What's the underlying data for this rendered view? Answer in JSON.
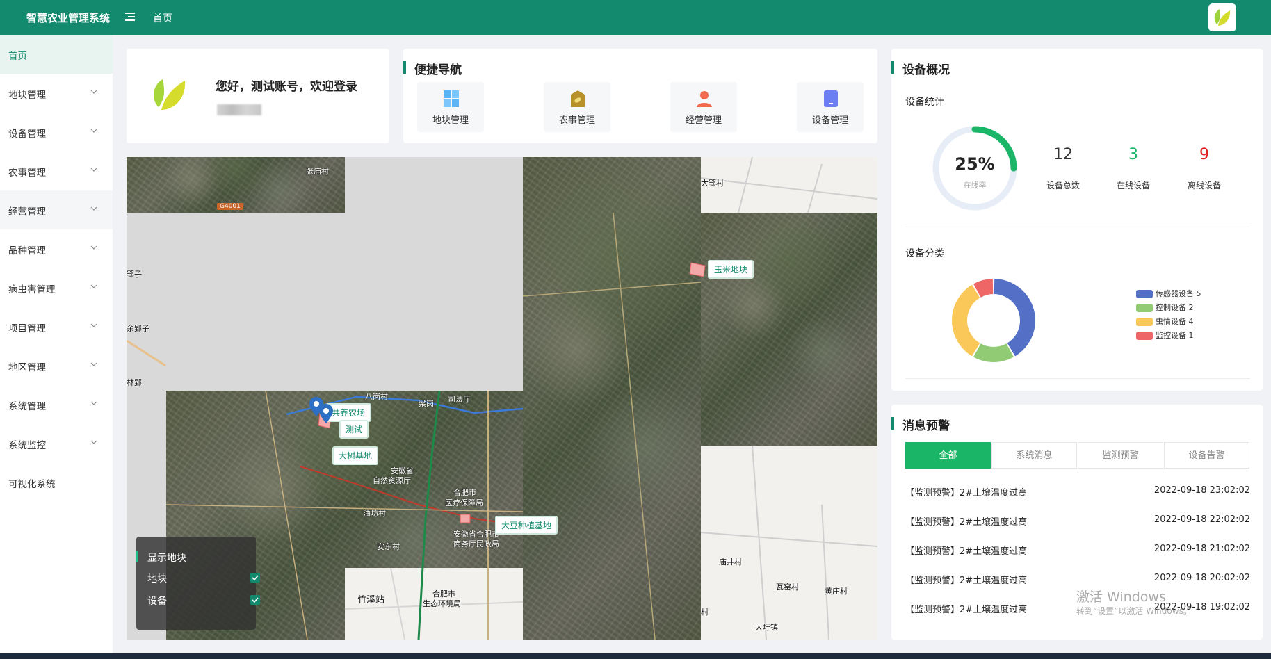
{
  "header": {
    "title": "智慧农业管理系统",
    "breadcrumb": "首页"
  },
  "sidebar": {
    "items": [
      {
        "label": "首页"
      },
      {
        "label": "地块管理"
      },
      {
        "label": "设备管理"
      },
      {
        "label": "农事管理"
      },
      {
        "label": "经营管理"
      },
      {
        "label": "品种管理"
      },
      {
        "label": "病虫害管理"
      },
      {
        "label": "项目管理"
      },
      {
        "label": "地区管理"
      },
      {
        "label": "系统管理"
      },
      {
        "label": "系统监控"
      },
      {
        "label": "可视化系统"
      }
    ]
  },
  "welcome": {
    "greeting": "您好，测试账号，欢迎登录"
  },
  "quick_nav": {
    "title": "便捷导航",
    "items": [
      {
        "label": "地块管理",
        "icon": "plot-icon"
      },
      {
        "label": "农事管理",
        "icon": "farming-icon"
      },
      {
        "label": "经营管理",
        "icon": "user-icon"
      },
      {
        "label": "设备管理",
        "icon": "device-icon"
      }
    ]
  },
  "map": {
    "place_labels": [
      "张庙村",
      "大郢村",
      "郢子",
      "余郢子",
      "林郢",
      "八岗村",
      "梁岗",
      "司法厅",
      "安徽省",
      "自然资源厅",
      "合肥市",
      "医疗保障局",
      "油坊村",
      "安东村",
      "安徽省合肥市",
      "商务厅民政局",
      "竹溪站",
      "合肥市",
      "生态环境局",
      "庙井村",
      "瓦窑村",
      "黄庄村",
      "大圩镇",
      "村"
    ],
    "road_badge": "G4001",
    "plot_tags": [
      "玉米地块",
      "共养农场",
      "测试",
      "大树基地",
      "大豆种植基地"
    ],
    "layers": {
      "title": "显示地块",
      "items": [
        {
          "label": "地块",
          "checked": true
        },
        {
          "label": "设备",
          "checked": true
        }
      ]
    }
  },
  "overview": {
    "title": "设备概况",
    "stats_title": "设备统计",
    "online_rate": "25%",
    "online_rate_value": 25,
    "online_rate_label": "在线率",
    "total": {
      "value": "12",
      "label": "设备总数",
      "color": "#333333"
    },
    "online": {
      "value": "3",
      "label": "在线设备",
      "color": "#1ab566"
    },
    "offline": {
      "value": "9",
      "label": "离线设备",
      "color": "#e02020"
    },
    "category_title": "设备分类",
    "categories": [
      {
        "label": "传感器设备 5",
        "value": 5,
        "color": "#5470c6"
      },
      {
        "label": "控制设备 2",
        "value": 2,
        "color": "#91cc75"
      },
      {
        "label": "虫情设备 4",
        "value": 4,
        "color": "#fac858"
      },
      {
        "label": "监控设备 1",
        "value": 1,
        "color": "#ee6666"
      }
    ]
  },
  "alerts": {
    "title": "消息预警",
    "tabs": [
      {
        "label": "全部"
      },
      {
        "label": "系统消息"
      },
      {
        "label": "监测预警"
      },
      {
        "label": "设备告警"
      }
    ],
    "rows": [
      {
        "text": "【监测预警】2#土壤温度过高",
        "time": "2022-09-18 23:02:02"
      },
      {
        "text": "【监测预警】2#土壤温度过高",
        "time": "2022-09-18 22:02:02"
      },
      {
        "text": "【监测预警】2#土壤温度过高",
        "time": "2022-09-18 21:02:02"
      },
      {
        "text": "【监测预警】2#土壤温度过高",
        "time": "2022-09-18 20:02:02"
      },
      {
        "text": "【监测预警】2#土壤温度过高",
        "time": "2022-09-18 19:02:02"
      }
    ]
  },
  "watermark": {
    "line1": "激活 Windows",
    "line2": "转到“设置”以激活 Windows。"
  }
}
